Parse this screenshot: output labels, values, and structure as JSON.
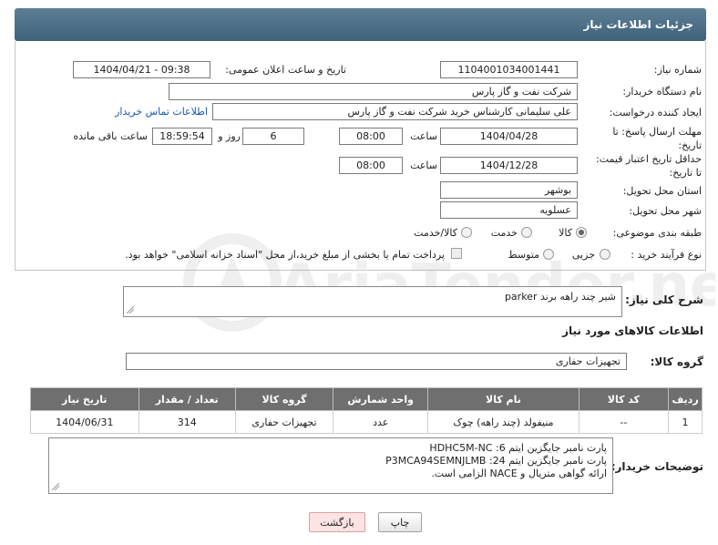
{
  "header": {
    "title": "جزئیات اطلاعات نیاز"
  },
  "fields": {
    "need_number_label": "شماره نیاز:",
    "need_number": "1104001034001441",
    "announce_label": "تاریخ و ساعت اعلان عمومی:",
    "announce_value": "1404/04/21 - 09:38",
    "buyer_org_label": "نام دستگاه خریدار:",
    "buyer_org": "شرکت نفت و گاز پارس",
    "creator_label": "ایجاد کننده درخواست:",
    "creator": "علی سلیمانی کارشناس خرید شرکت نفت و گاز پارس",
    "contact_link": "اطلاعات تماس خریدار",
    "deadline_label": "مهلت ارسال پاسخ: تا تاریخ:",
    "deadline_date": "1404/04/28",
    "time_label": "ساعت",
    "deadline_time": "08:00",
    "days_value": "6",
    "days_label": "روز و",
    "remaining_time": "18:59:54",
    "remaining_label": "ساعت باقی مانده",
    "validity_label": "حداقل تاریخ اعتبار قیمت: تا تاریخ:",
    "validity_date": "1404/12/28",
    "validity_time": "08:00",
    "province_label": "استان محل تحویل:",
    "province": "بوشهر",
    "city_label": "شهر محل تحویل:",
    "city": "عسلویه",
    "category_label": "طبقه بندی موضوعی:",
    "category_options": [
      "کالا",
      "خدمت",
      "کالا/خدمت"
    ],
    "purchase_type_label": "نوع فرآیند خرید :",
    "purchase_options": [
      "جزیی",
      "متوسط"
    ],
    "payment_note": "پرداخت تمام یا بخشی از مبلغ خرید،از محل \"اسناد خزانه اسلامی\" خواهد بود."
  },
  "description": {
    "label": "شرح کلی نیاز:",
    "value": "شیر چند راهه برند parker"
  },
  "goods": {
    "section_title": "اطلاعات کالاهای مورد نیاز",
    "group_label": "گروه کالا:",
    "group_value": "تجهیزات حفاری",
    "columns": [
      "ردیف",
      "کد کالا",
      "نام کالا",
      "واحد شمارش",
      "گروه کالا",
      "تعداد / مقدار",
      "تاریخ نیاز"
    ],
    "rows": [
      [
        "1",
        "--",
        "منیفولد (چند راهه) چوک",
        "عدد",
        "تجهیزات حفاری",
        "314",
        "1404/06/31"
      ]
    ]
  },
  "buyer_notes": {
    "label": "توضیحات خریدار:",
    "lines": [
      "پارت نامبر جایگزین ایتم 6: HDHC5M-NC",
      "پارت نامبر جایگزین ایتم 24: P3MCA94SEMNJLMB",
      "ارائه گواهی متریال و NACE الزامی است."
    ]
  },
  "buttons": {
    "print": "چاپ",
    "back": "بازگشت"
  },
  "watermark": "AriaTender.neT"
}
